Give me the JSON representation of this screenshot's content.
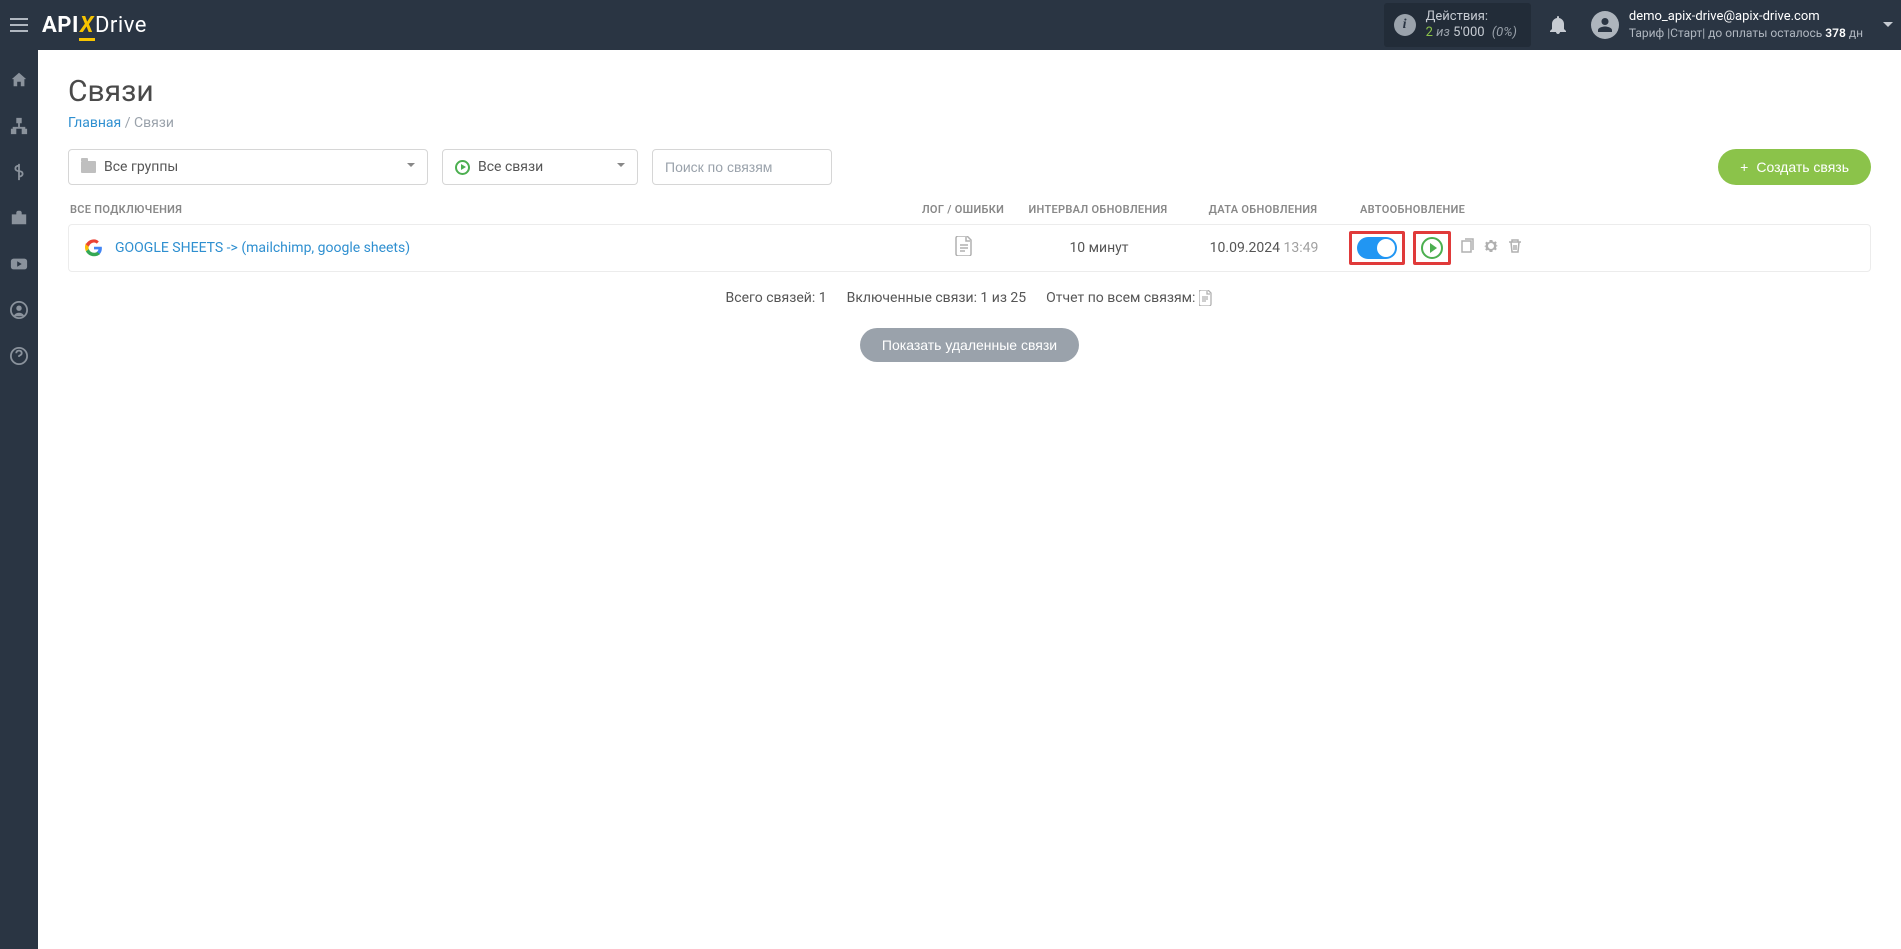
{
  "header": {
    "logo": {
      "part1": "API",
      "part2": "X",
      "part3": "Drive"
    },
    "actions": {
      "label": "Действия:",
      "count": "2",
      "of": "из",
      "limit": "5'000",
      "pct": "(0%)"
    },
    "user": {
      "email": "demo_apix-drive@apix-drive.com",
      "plan_prefix": "Тариф |Старт| до оплаты осталось ",
      "days": "378",
      "days_suffix": " дн"
    }
  },
  "page": {
    "title": "Связи",
    "breadcrumb": {
      "home": "Главная",
      "sep": "/",
      "current": "Связи"
    }
  },
  "filters": {
    "groups": "Все группы",
    "status": "Все связи",
    "search_placeholder": "Поиск по связям",
    "create": "Создать связь"
  },
  "columns": {
    "name": "ВСЕ ПОДКЛЮЧЕНИЯ",
    "log": "ЛОГ / ОШИБКИ",
    "interval": "ИНТЕРВАЛ ОБНОВЛЕНИЯ",
    "date": "ДАТА ОБНОВЛЕНИЯ",
    "auto": "АВТООБНОВЛЕНИЕ"
  },
  "rows": [
    {
      "name": "GOOGLE SHEETS -> (mailchimp, google sheets)",
      "interval": "10 минут",
      "date": "10.09.2024",
      "time": "13:49"
    }
  ],
  "summary": {
    "total": "Всего связей: 1",
    "enabled": "Включенные связи: 1 из 25",
    "report": "Отчет по всем связям:"
  },
  "show_deleted": "Показать удаленные связи"
}
